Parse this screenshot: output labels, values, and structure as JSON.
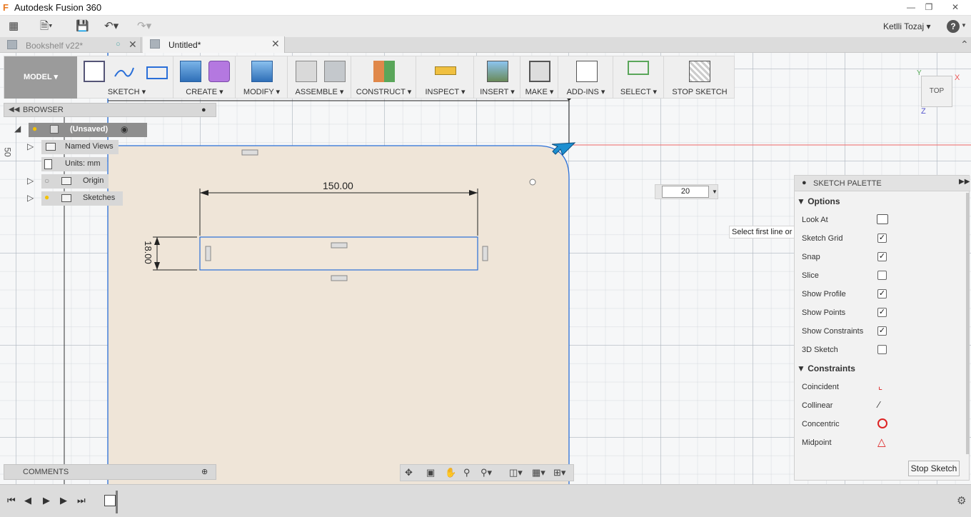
{
  "window": {
    "title": "Autodesk Fusion 360",
    "logo_letter": "F"
  },
  "quick_access": {
    "user_name": "Ketlli Tozaj",
    "help": "?"
  },
  "tabs": [
    {
      "label": "Bookshelf v22*",
      "active": false
    },
    {
      "label": "Untitled*",
      "active": true
    }
  ],
  "toolbar": {
    "workspace": "MODEL",
    "groups": [
      {
        "label": "SKETCH"
      },
      {
        "label": "CREATE"
      },
      {
        "label": "MODIFY"
      },
      {
        "label": "ASSEMBLE"
      },
      {
        "label": "CONSTRUCT"
      },
      {
        "label": "INSPECT"
      },
      {
        "label": "INSERT"
      },
      {
        "label": "MAKE"
      },
      {
        "label": "ADD-INS"
      },
      {
        "label": "SELECT"
      },
      {
        "label": "STOP SKETCH"
      }
    ]
  },
  "browser": {
    "title": "BROWSER",
    "root": "(Unsaved)",
    "items": [
      {
        "label": "Named Views"
      },
      {
        "label": "Units: mm"
      },
      {
        "label": "Origin"
      },
      {
        "label": "Sketches"
      }
    ]
  },
  "comments": {
    "title": "COMMENTS"
  },
  "canvas": {
    "ruler_label": "50",
    "dim_width": "150.00",
    "dim_height": "18.00",
    "fillet_input": "20",
    "tooltip": "Select first line or arc"
  },
  "viewcube": {
    "face": "TOP",
    "axis_x": "X",
    "axis_y": "Y",
    "axis_z": "Z"
  },
  "palette": {
    "title": "SKETCH PALETTE",
    "options_title": "Options",
    "options": [
      {
        "label": "Look At",
        "type": "button"
      },
      {
        "label": "Sketch Grid",
        "checked": true
      },
      {
        "label": "Snap",
        "checked": true
      },
      {
        "label": "Slice",
        "checked": false
      },
      {
        "label": "Show Profile",
        "checked": true
      },
      {
        "label": "Show Points",
        "checked": true
      },
      {
        "label": "Show Constraints",
        "checked": true
      },
      {
        "label": "3D Sketch",
        "checked": false
      }
    ],
    "constraints_title": "Constraints",
    "constraints": [
      {
        "label": "Coincident"
      },
      {
        "label": "Collinear"
      },
      {
        "label": "Concentric"
      },
      {
        "label": "Midpoint"
      }
    ],
    "stop_button": "Stop Sketch"
  },
  "colors": {
    "sketch_line": "#2a6fd8",
    "profile_fill": "#efe5d8",
    "accent_arrow": "#1e8fd0"
  }
}
